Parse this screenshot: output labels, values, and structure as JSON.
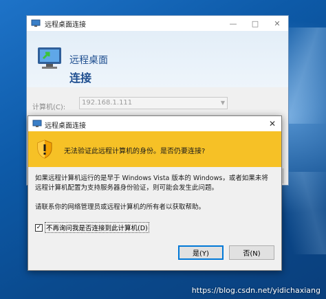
{
  "back_window": {
    "title": "远程桌面连接",
    "banner_line1": "远程桌面",
    "banner_line2": "连接",
    "computer_label": "计算机(C):",
    "computer_value": "192.168.1.111"
  },
  "dialog": {
    "title": "远程桌面连接",
    "warning": "无法验证此远程计算机的身份。是否仍要连接?",
    "body_line1": "如果远程计算机运行的是早于 Windows Vista 版本的 Windows，或者如果未将",
    "body_line2": "远程计算机配置为支持服务器身份验证，则可能会发生此问题。",
    "body_line3": "请联系你的网络管理员或远程计算机的所有者以获取帮助。",
    "checkbox_label": "不再询问我是否连接到此计算机(D)",
    "checkbox_checked": true,
    "yes_label": "是(Y)",
    "no_label": "否(N)"
  },
  "watermark": "https://blog.csdn.net/yidichaxiang",
  "colors": {
    "warning_bar": "#f6c126",
    "banner_text": "#1d4d8f",
    "focus_border": "#0078d7"
  }
}
